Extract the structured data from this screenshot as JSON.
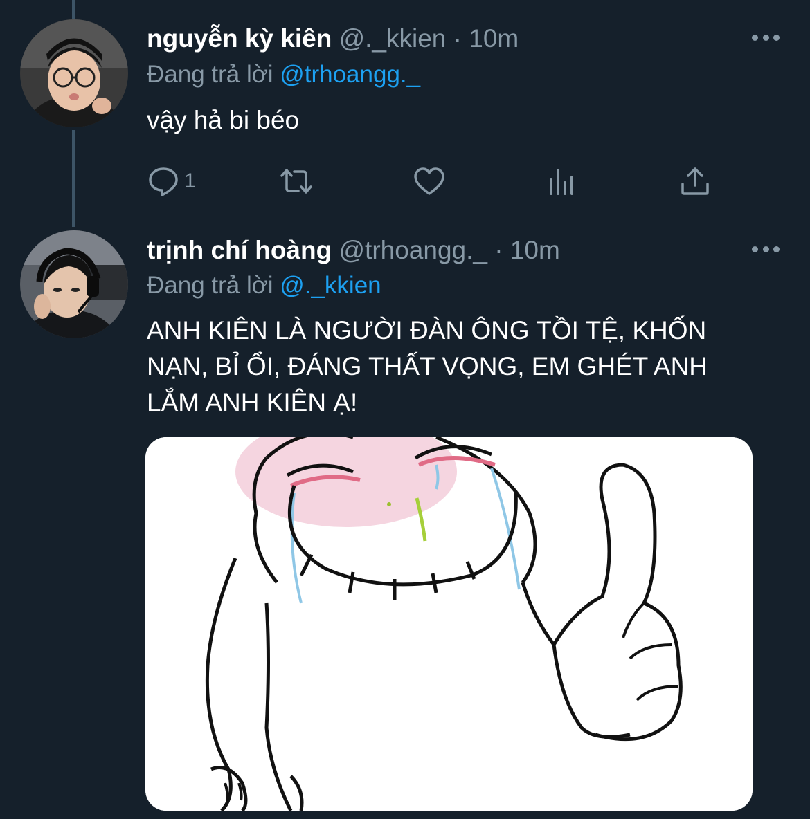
{
  "tweets": [
    {
      "name": "nguyễn kỳ kiên",
      "handle": "@._kkien",
      "separator": "·",
      "time": "10m",
      "reply_prefix": "Đang trả lời",
      "reply_to": "@trhoangg._",
      "text": "vậy hả bi béo",
      "reply_count": "1"
    },
    {
      "name": "trịnh chí hoàng",
      "handle": "@trhoangg._",
      "separator": "·",
      "time": "10m",
      "reply_prefix": "Đang trả lời",
      "reply_to": "@._kkien",
      "text": "ANH KIÊN LÀ NGƯỜI ĐÀN ÔNG TỒI TỆ, KHỐN NẠN, BỈ ỔI, ĐÁNG THẤT VỌNG, EM GHÉT ANH LẮM ANH KIÊN Ạ!"
    }
  ],
  "icons": {
    "reply": "reply-icon",
    "retweet": "retweet-icon",
    "like": "heart-icon",
    "stats": "stats-icon",
    "share": "share-icon",
    "more": "more-icon"
  },
  "colors": {
    "background": "#15202b",
    "secondary_text": "#8899a6",
    "link": "#1da1f2",
    "thread_line": "#3d5466"
  }
}
